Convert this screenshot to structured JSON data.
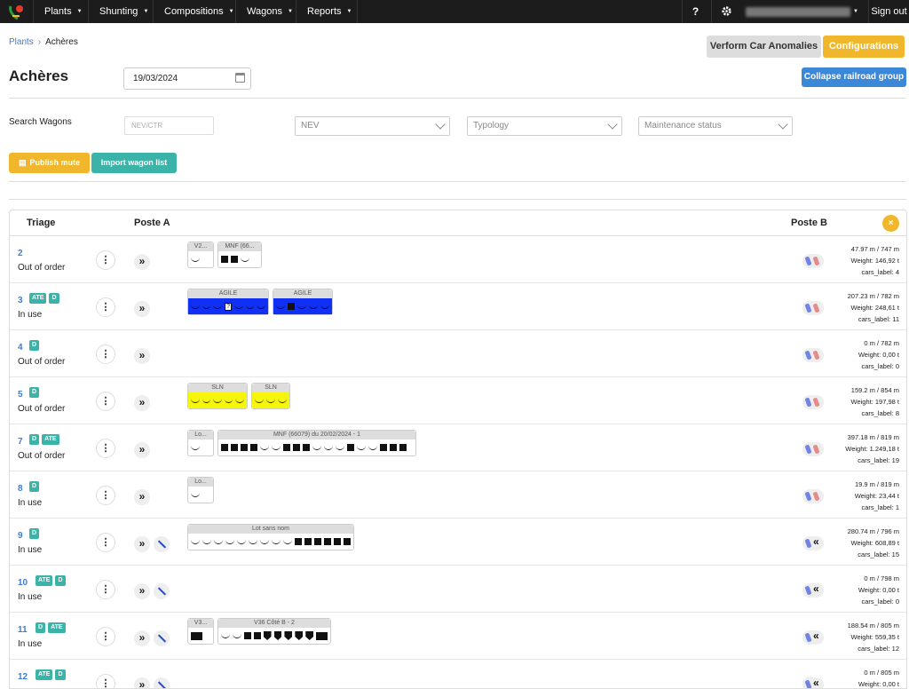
{
  "nav": {
    "items": [
      {
        "label": "Plants"
      },
      {
        "label": "Shunting"
      },
      {
        "label": "Compositions"
      },
      {
        "label": "Wagons"
      },
      {
        "label": "Reports"
      }
    ],
    "help": "?",
    "signout": "Sign out"
  },
  "breadcrumb": {
    "root": "Plants",
    "current": "Achères"
  },
  "buttons": {
    "anomalies": "Verform Car Anomalies",
    "configurations": "Configurations",
    "collapse": "Collapse railroad group",
    "publish": "Publish mute",
    "import": "Import wagon list"
  },
  "page": {
    "title": "Achères",
    "date": "19/03/2024"
  },
  "filters": {
    "search_label": "Search Wagons",
    "search_placeholder": "NEV/CTR",
    "nev": "NEV",
    "typology": "Typology",
    "maintenance": "Maintenance status"
  },
  "table": {
    "triage": "Triage",
    "poste_a": "Poste A",
    "poste_b": "Poste B",
    "close": "×"
  },
  "rows": [
    {
      "num": "2",
      "badges": [],
      "status": "Out of order",
      "length": "47.97 m / 747 m",
      "weight": "Weight: 146,92 t",
      "cars": "cars_label: 4",
      "wrench": false,
      "back": false,
      "lots": [
        {
          "title": "V2...",
          "color": "",
          "cars": [
            "e"
          ]
        },
        {
          "title": "MNF (66...",
          "color": "",
          "cars": [
            "c",
            "c",
            "e"
          ]
        }
      ]
    },
    {
      "num": "3",
      "badges": [
        "ATE",
        "D"
      ],
      "status": "In use",
      "length": "207.23 m / 782 m",
      "weight": "Weight: 248,61 t",
      "cars": "cars_label: 11",
      "wrench": false,
      "back": false,
      "lots": [
        {
          "title": "AGILE",
          "color": "blue",
          "cars": [
            "e",
            "e",
            "e",
            "q",
            "e",
            "e",
            "e"
          ]
        },
        {
          "title": "AGILE",
          "color": "blue",
          "cars": [
            "e",
            "c",
            "e",
            "e",
            "e"
          ]
        }
      ]
    },
    {
      "num": "4",
      "badges": [
        "D"
      ],
      "status": "Out of order",
      "length": "0 m / 782 m",
      "weight": "Weight: 0,00 t",
      "cars": "cars_label: 0",
      "wrench": false,
      "back": false,
      "lots": []
    },
    {
      "num": "5",
      "badges": [
        "D"
      ],
      "status": "Out of order",
      "length": "159.2 m / 854 m",
      "weight": "Weight: 197,98 t",
      "cars": "cars_label: 8",
      "wrench": false,
      "back": false,
      "lots": [
        {
          "title": "SLN",
          "color": "yellow",
          "cars": [
            "e",
            "e",
            "e",
            "e",
            "e"
          ]
        },
        {
          "title": "SLN",
          "color": "yellow",
          "cars": [
            "e",
            "e",
            "e"
          ]
        }
      ]
    },
    {
      "num": "7",
      "badges": [
        "D",
        "ATE"
      ],
      "status": "Out of order",
      "length": "397.18 m / 819 m",
      "weight": "Weight: 1.249,18 t",
      "cars": "cars_label: 19",
      "wrench": false,
      "back": false,
      "lots": [
        {
          "title": "Lo...",
          "color": "",
          "cars": [
            "e"
          ]
        },
        {
          "title": "MNF (66079) du 20/02/2024 - 1",
          "color": "",
          "cars": [
            "c",
            "c",
            "c",
            "c",
            "e",
            "e",
            "c",
            "c",
            "c",
            "e",
            "e",
            "e",
            "c",
            "e",
            "e",
            "c",
            "c",
            "c"
          ]
        }
      ]
    },
    {
      "num": "8",
      "badges": [
        "D"
      ],
      "status": "In use",
      "length": "19.9 m / 819 m",
      "weight": "Weight: 23,44 t",
      "cars": "cars_label: 1",
      "wrench": false,
      "back": false,
      "lots": [
        {
          "title": "Lo...",
          "color": "",
          "cars": [
            "e"
          ]
        }
      ]
    },
    {
      "num": "9",
      "badges": [
        "D"
      ],
      "status": "In use",
      "length": "280.74 m / 796 m",
      "weight": "Weight: 608,89 t",
      "cars": "cars_label: 15",
      "wrench": true,
      "back": true,
      "lots": [
        {
          "title": "Lot sans nom",
          "color": "",
          "cars": [
            "e",
            "e",
            "e",
            "e",
            "e",
            "e",
            "e",
            "e",
            "e",
            "c",
            "c",
            "c",
            "c",
            "c",
            "c"
          ]
        }
      ]
    },
    {
      "num": "10",
      "badges": [
        "ATE",
        "D"
      ],
      "status": "In use",
      "length": "0 m / 798 m",
      "weight": "Weight: 0,00 t",
      "cars": "cars_label: 0",
      "wrench": true,
      "back": true,
      "lots": []
    },
    {
      "num": "11",
      "badges": [
        "D",
        "ATE"
      ],
      "status": "In use",
      "length": "188.54 m / 805 m",
      "weight": "Weight: 559,35 t",
      "cars": "cars_label: 12",
      "wrench": true,
      "back": true,
      "lots": [
        {
          "title": "V3...",
          "color": "",
          "cars": [
            "l"
          ]
        },
        {
          "title": "V36 Côté B - 2",
          "color": "",
          "cars": [
            "e",
            "e",
            "c",
            "c",
            "s",
            "s",
            "s",
            "s",
            "s",
            "l"
          ]
        }
      ]
    },
    {
      "num": "12",
      "badges": [
        "ATE",
        "D"
      ],
      "status": "",
      "length": "0 m / 805 m",
      "weight": "Weight: 0,00 t",
      "cars": "",
      "wrench": true,
      "back": true,
      "lots": []
    }
  ],
  "colors": {
    "accent": "#f1b72c",
    "teal": "#3cb3a8",
    "blue": "#3b87d8",
    "link": "#3b7dd8"
  },
  "icons": {
    "logo": "plant-logo",
    "settings": "gear-icon",
    "forward": "double-chevron-right-icon",
    "back": "double-chevron-left-icon"
  }
}
